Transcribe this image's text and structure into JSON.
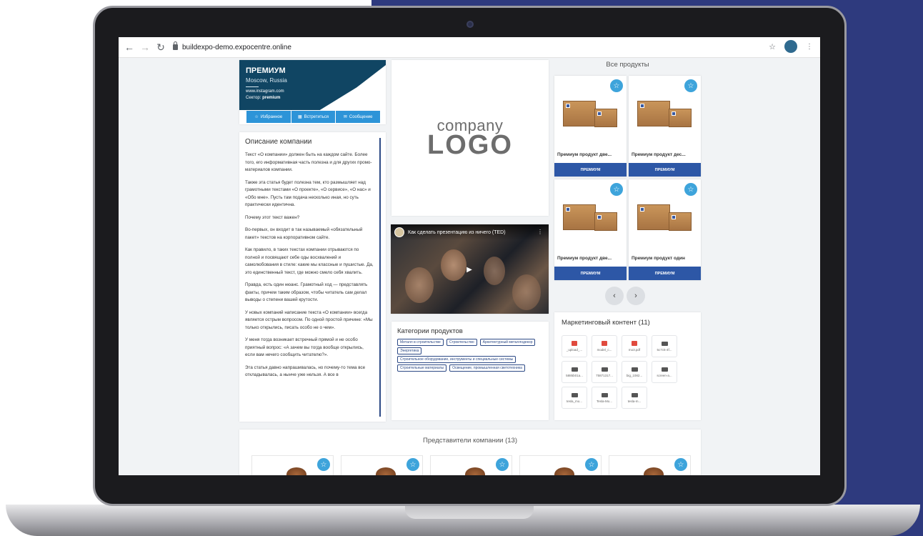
{
  "browser": {
    "url": "buildexpo-demo.expocentre.online"
  },
  "company": {
    "title": "ПРЕМИУМ",
    "city": "Moscow, Russia",
    "website": "www.instagram.com",
    "sector_label": "Сектор:",
    "sector_value": "premium",
    "buttons": [
      "Избранное",
      "Встретиться",
      "Сообщение"
    ]
  },
  "description": {
    "heading": "Описание компании",
    "paragraphs": [
      "Текст «О компании» должен быть на каждом сайте. Более того, его информативная часть полезна и для других промо-материалов компании.",
      "Также эта статья будет полезна тем, кто размышляет над грамотными текстами «О проекте», «О сервисе», «О нас» и «Обо мне». Пусть там подача несколько иная, но суть практически идентична.",
      "Почему этот текст важен?",
      "Во-первых, он входит в так называемый «обязательный пакет» текстов на корпоративном сайте.",
      "Как правило, в таких текстах компании отрываются по полной и посвящают себе оды восхвалений и самолюбования в стиле: какие мы классные и пушистые. Да, это единственный текст, где можно смело себя хвалить.",
      "Правда, есть один нюанс. Грамотный ход — представлять факты, причем таким образом, чтобы читатель сам делал выводы о степени вашей крутости.",
      "У новых компаний написание текста «О компании» всегда является острым вопросом. По одной простой причине: «Мы только открылись, писать особо не о чем».",
      "У меня тогда возникает встречный прямой и не особо приятный вопрос: «А зачем вы тогда вообще открылись, если вам нечего сообщить читателю?».",
      "Эта статья давно напрашивалась, но почему-то тема все откладывалась, а нынче уже нельзя. А все в"
    ]
  },
  "logo": {
    "line1": "company",
    "line2": "LOGO"
  },
  "video": {
    "title": "Как сделать презентацию из ничего (TED)"
  },
  "categories": {
    "heading": "Категории продуктов",
    "tags": [
      "Металл в строительстве",
      "Строительство",
      "Архитектурный металлодекор",
      "Энергетика",
      "Строительное оборудование, инструменты и специальные системы",
      "Строительные материалы",
      "Освещение, промышленная светотехника"
    ]
  },
  "products": {
    "heading": "Все продукты",
    "items": [
      {
        "name": "Премиум продукт две...",
        "badge": "ПРЕМИУМ"
      },
      {
        "name": "Премиум продукт дес...",
        "badge": "ПРЕМИУМ"
      },
      {
        "name": "Премиум продукт две...",
        "badge": "ПРЕМИУМ"
      },
      {
        "name": "Премиум продукт один",
        "badge": "ПРЕМИУМ"
      }
    ]
  },
  "marketing": {
    "heading": "Маркетинговый контент (11)",
    "files": [
      {
        "name": "_upload_...",
        "type": "pdf"
      },
      {
        "name": "model_c...",
        "type": "pdf"
      },
      {
        "name": "mo3.pdf",
        "type": "pdf"
      },
      {
        "name": "5c7c5-4f...",
        "type": "image"
      },
      {
        "name": "5885b01a...",
        "type": "image"
      },
      {
        "name": "75871317...",
        "type": "image"
      },
      {
        "name": "big_1082...",
        "type": "image"
      },
      {
        "name": "screen-a...",
        "type": "image"
      },
      {
        "name": "tesla_mo...",
        "type": "image"
      },
      {
        "name": "Tesla-Mo...",
        "type": "image"
      },
      {
        "name": "tesla-m...",
        "type": "image"
      }
    ]
  },
  "representatives": {
    "heading": "Представители компании (13)"
  },
  "colors": {
    "brand_dark": "#104563",
    "accent": "#2d94d8",
    "premium_badge": "#2d57a6"
  }
}
